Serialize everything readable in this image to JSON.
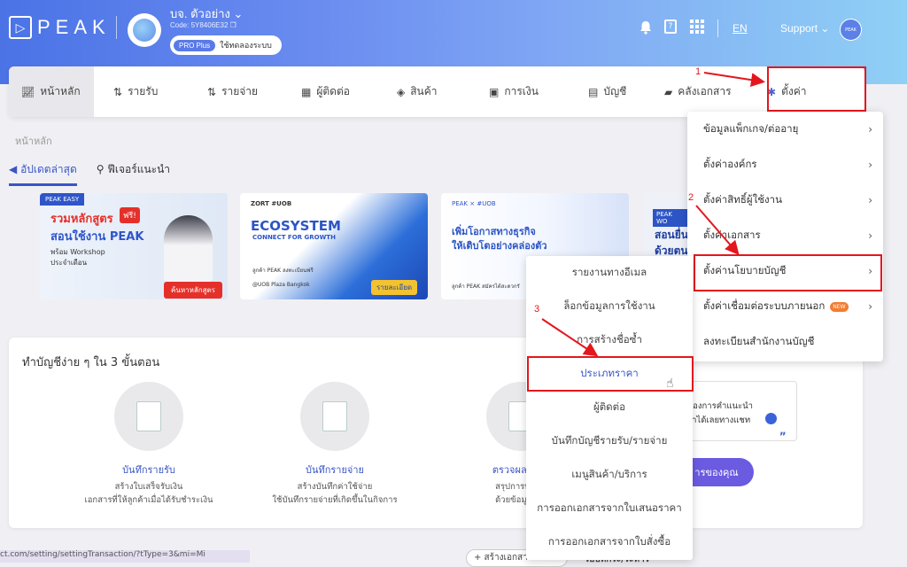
{
  "header": {
    "logo_text": "PEAK",
    "company_name": "บจ. ตัวอย่าง",
    "company_code": "Code: 5Y8406E32",
    "plan_badge": "PRO Plus",
    "plan_status": "ใช้ทดลองระบบ",
    "q_icon_text": "?",
    "language": "EN",
    "support": "Support",
    "user_avatar": "PEAK"
  },
  "nav": {
    "items": [
      {
        "label": "หน้าหลัก",
        "icon": "chart-icon"
      },
      {
        "label": "รายรับ",
        "icon": "income-icon"
      },
      {
        "label": "รายจ่าย",
        "icon": "expense-icon"
      },
      {
        "label": "ผู้ติดต่อ",
        "icon": "contacts-icon"
      },
      {
        "label": "สินค้า",
        "icon": "box-icon"
      },
      {
        "label": "การเงิน",
        "icon": "money-icon"
      },
      {
        "label": "บัญชี",
        "icon": "book-icon"
      },
      {
        "label": "คลังเอกสาร",
        "icon": "folder-icon"
      },
      {
        "label": "ตั้งค่า",
        "icon": "gear-icon"
      }
    ]
  },
  "page": {
    "breadcrumb": "หน้าหลัก",
    "tab_updates": "อัปเดตล่าสุด",
    "tab_features": "ฟีเจอร์แนะนำ",
    "steps_title": "ทำบัญชีง่าย ๆ ใน 3 ขั้นตอน",
    "chat_line1": "ต้องการคำแนะนำ",
    "chat_line2": "ราได้เลยทางแชท",
    "cta_button": "ารของคุณ"
  },
  "banners": [
    {
      "tag": "PEAK EASY",
      "title1": "รวมหลักสูตร",
      "title2": "สอนใช้งาน PEAK",
      "sub1": "พร้อม Workshop",
      "sub2": "ประจำเดือน",
      "badge": "ฟรี!",
      "btn": "ค้นหาหลักสูตร"
    },
    {
      "tag": "ZORT #UOB",
      "title1": "ECOSYSTEM",
      "title2": "CONNECT FOR GROWTH",
      "sub1": "ลูกค้า PEAK ลงทะเบียนฟรี",
      "sub2": "@UOB Plaza Bangkok",
      "btn": "รายละเอียด"
    },
    {
      "tag": "PEAK × #UOB",
      "title1": "เพิ่มโอกาสทางธุรกิจ",
      "title2": "ให้เติบโตอย่างคล่องตัว",
      "sub1": "ลูกค้า PEAK สมัครได้สะดวกรั"
    },
    {
      "tag": "PEAK WO",
      "title1": "สอนยื่น",
      "title2": "ด้วยตน"
    }
  ],
  "steps": [
    {
      "title": "บันทึกรายรับ",
      "desc1": "สร้างใบเสร็จรับเงิน",
      "desc2": "เอกสารที่ให้ลูกค้าเมื่อได้รับชำระเงิน"
    },
    {
      "title": "บันทึกรายจ่าย",
      "desc1": "สร้างบันทึกค่าใช้จ่าย",
      "desc2": "ใช้บันทึกรายจ่ายที่เกิดขึ้นในกิจการ"
    },
    {
      "title": "ตรวจผลประก",
      "desc1": "สรุปการบันทึก",
      "desc2": "ด้วยข้อมูลงบก"
    }
  ],
  "settings_menu": [
    "ข้อมูลแพ็กเกจ/ต่ออายุ",
    "ตั้งค่าองค์กร",
    "ตั้งค่าสิทธิ์ผู้ใช้งาน",
    "ตั้งค่าเอกสาร",
    "ตั้งค่านโยบายบัญชี",
    "ตั้งค่าเชื่อมต่อระบบภายนอก",
    "ลงทะเบียนสำนักงานบัญชี"
  ],
  "new_badge": "NEW",
  "policy_submenu": [
    "รายงานทางอีเมล",
    "ล็อกข้อมูลการใช้งาน",
    "การสร้างชื่อซ้ำ",
    "ประเภทราคา",
    "ผู้ติดต่อ",
    "บันทึกบัญชีรายรับ/รายจ่าย",
    "เมนูสินค้า/บริการ",
    "การออกเอกสารจากใบเสนอราคา",
    "การออกเอกสารจากใบสั่งซื้อ"
  ],
  "annotations": {
    "n1": "1",
    "n2": "2",
    "n3": "3",
    "accent": "#e3171d"
  },
  "footer": {
    "url": "ct.com/setting/settingTransaction/?tType=3&mi=Mi",
    "create_doc": "+ สร้างเอกสาร",
    "doc_status": "รอบที่กระ/ระหาร"
  }
}
